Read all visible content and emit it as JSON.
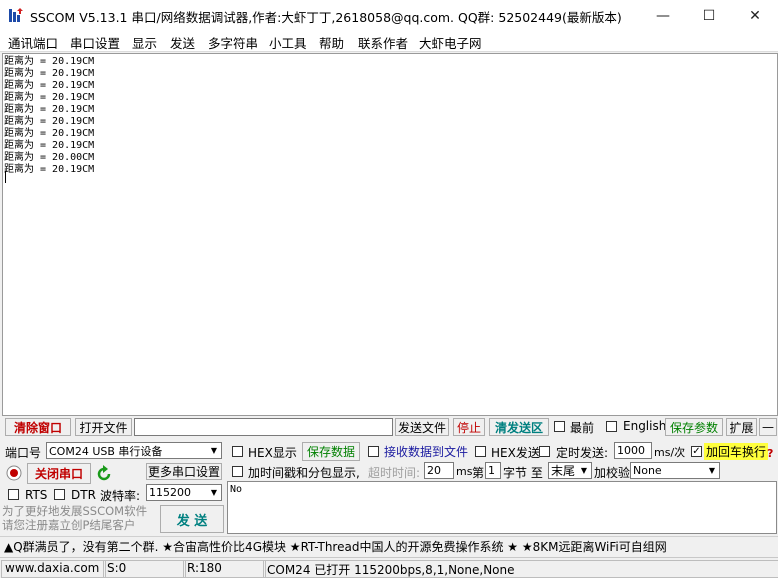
{
  "window": {
    "title": "SSCOM V5.13.1 串口/网络数据调试器,作者:大虾丁丁,2618058@qq.com. QQ群: 52502449(最新版本)",
    "minimize": "—",
    "maximize": "☐",
    "close": "✕"
  },
  "menu": [
    "通讯端口",
    "串口设置",
    "显示",
    "发送",
    "多字符串",
    "小工具",
    "帮助",
    "联系作者",
    "大虾电子网"
  ],
  "receive": {
    "lines": [
      "距离为 = 20.19CM",
      "距离为 = 20.19CM",
      "距离为 = 20.19CM",
      "距离为 = 20.19CM",
      "距离为 = 20.19CM",
      "距离为 = 20.19CM",
      "距离为 = 20.19CM",
      "距离为 = 20.19CM",
      "距离为 = 20.00CM",
      "距离为 = 20.19CM"
    ]
  },
  "toolbar": {
    "clear": "清除窗口",
    "open_file": "打开文件",
    "send_file": "发送文件",
    "stop": "停止",
    "clear_send": "清发送区",
    "front": "最前",
    "english": "English",
    "save_params": "保存参数",
    "expand": "扩展",
    "collapse": "—"
  },
  "port": {
    "label": "端口号",
    "value": "COM24 USB 串行设备",
    "close_btn": "关闭串口",
    "more_settings": "更多串口设置",
    "rts": "RTS",
    "dtr": "DTR",
    "baud_label": "波特率:",
    "baud": "115200"
  },
  "options": {
    "hex_display": "HEX显示",
    "save_data": "保存数据",
    "recv_to_file": "接收数据到文件",
    "hex_send": "HEX发送",
    "timed_send": "定时发送:",
    "interval": "1000",
    "interval_unit": "ms/次",
    "add_crlf": "加回车换行",
    "add_crlf_checked": "✓",
    "help": "?",
    "timestamp": "加时间戳和分包显示,",
    "timeout_label": "超时时间:",
    "timeout": "20",
    "timeout_unit": "ms",
    "nth": "第",
    "byte_index": "1",
    "byte_to": "字节 至",
    "end_select": "末尾",
    "checksum": "加校验",
    "checksum_value": "None"
  },
  "send": {
    "text": "No",
    "button": "发 送",
    "promo": "为了更好地发展SSCOM软件\n请您注册嘉立创P结尾客户"
  },
  "ticker": "▲Q群满员了，没有第二个群. ★合宙高性价比4G模块 ★RT-Thread中国人的开源免费操作系统 ★ ★8KM远距离WiFi可自组网",
  "status": {
    "site": "www.daxia.com",
    "sent": "S:0",
    "received": "R:180",
    "port_state": "COM24 已打开  115200bps,8,1,None,None"
  }
}
